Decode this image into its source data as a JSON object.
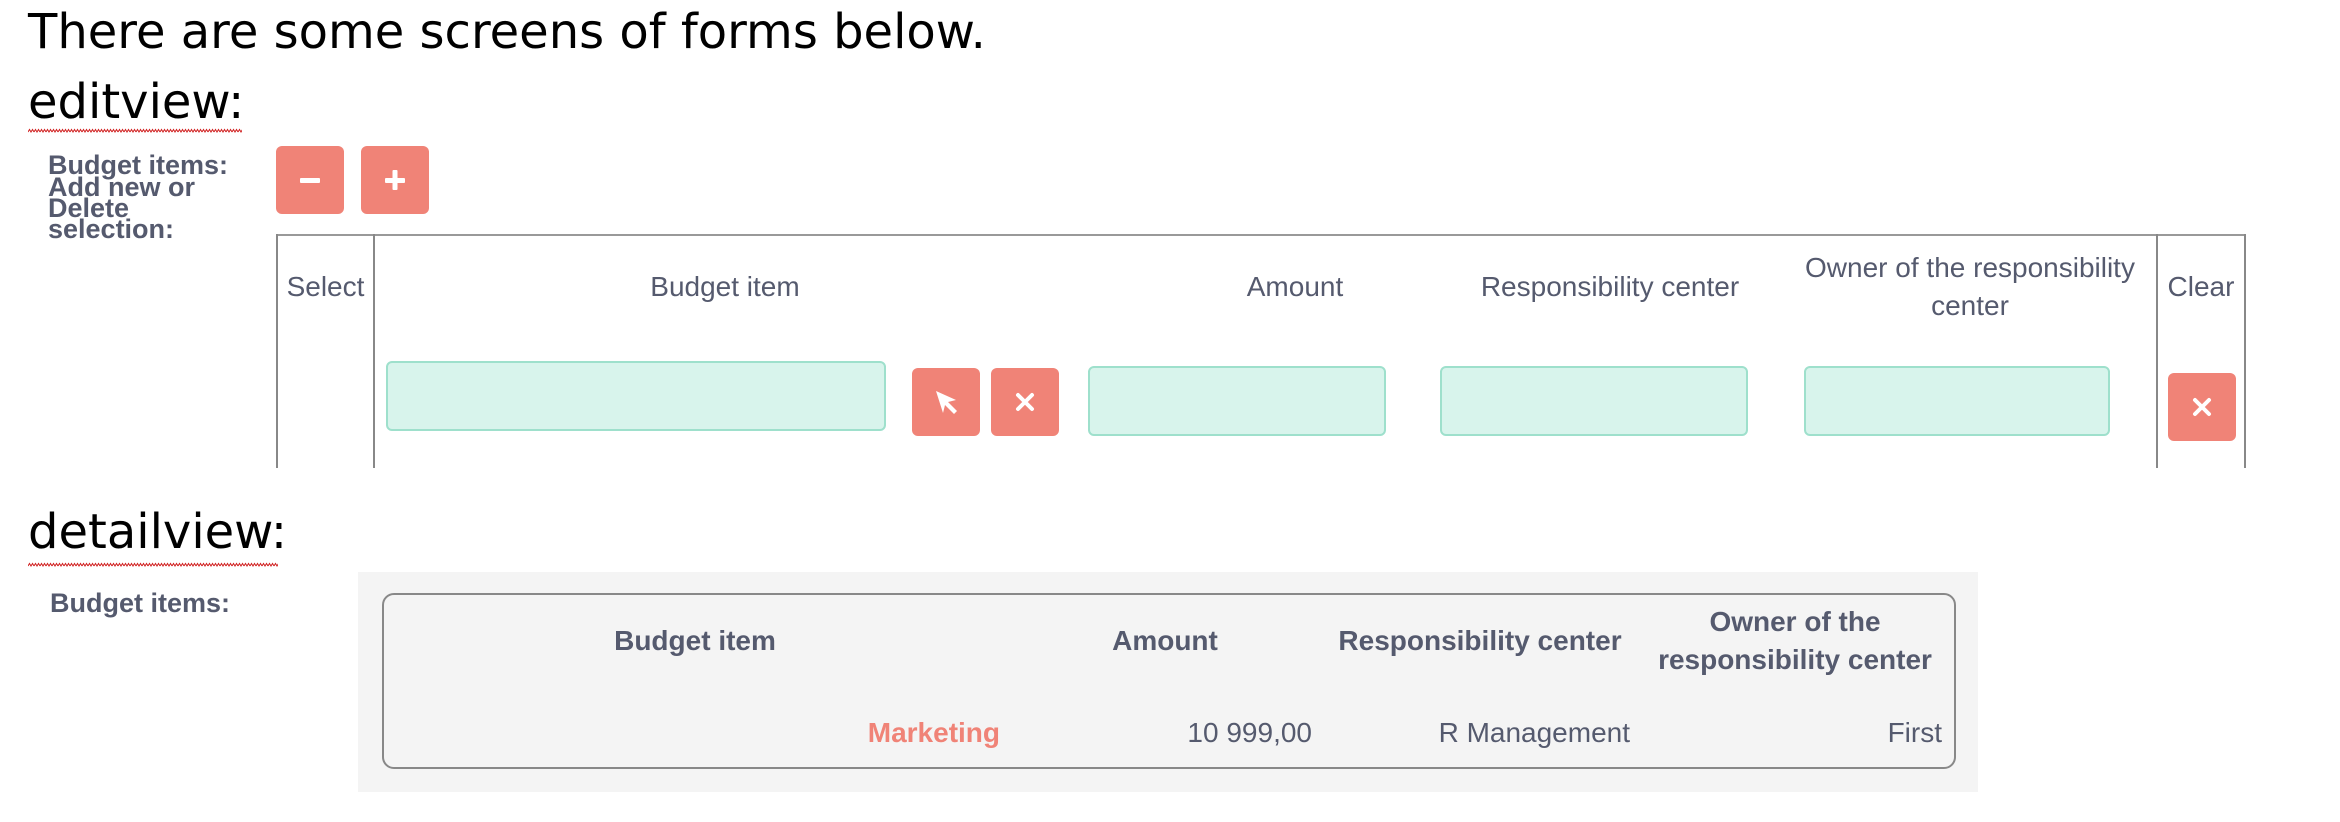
{
  "intro": "There are some screens of forms below.",
  "editview": {
    "heading": "editview:",
    "label_budget_items": "Budget items:",
    "label_add_new": "Add new or",
    "label_delete": "Delete",
    "label_selection": "selection:",
    "minus_button_icon": "minus-icon",
    "plus_button_icon": "plus-icon",
    "columns": {
      "select": "Select",
      "budget_item": "Budget item",
      "amount": "Amount",
      "responsibility_center": "Responsibility center",
      "owner_line1": "Owner of the responsibility",
      "owner_line2": "center",
      "clear": "Clear"
    },
    "row": {
      "budget_item": "",
      "amount": "",
      "responsibility_center": "",
      "owner": ""
    }
  },
  "detailview": {
    "heading": "detailview:",
    "label_budget_items": "Budget items:",
    "columns": {
      "budget_item": "Budget item",
      "amount": "Amount",
      "responsibility_center": "Responsibility center",
      "owner_line1": "Owner of the",
      "owner_line2": "responsibility center"
    },
    "row": {
      "budget_item": "Marketing",
      "amount": "10 999,00",
      "responsibility_center": "R Management",
      "owner": "First"
    }
  },
  "colors": {
    "accent": "#f08377",
    "field_bg": "#d8f4ec",
    "label_text": "#555a6e"
  }
}
